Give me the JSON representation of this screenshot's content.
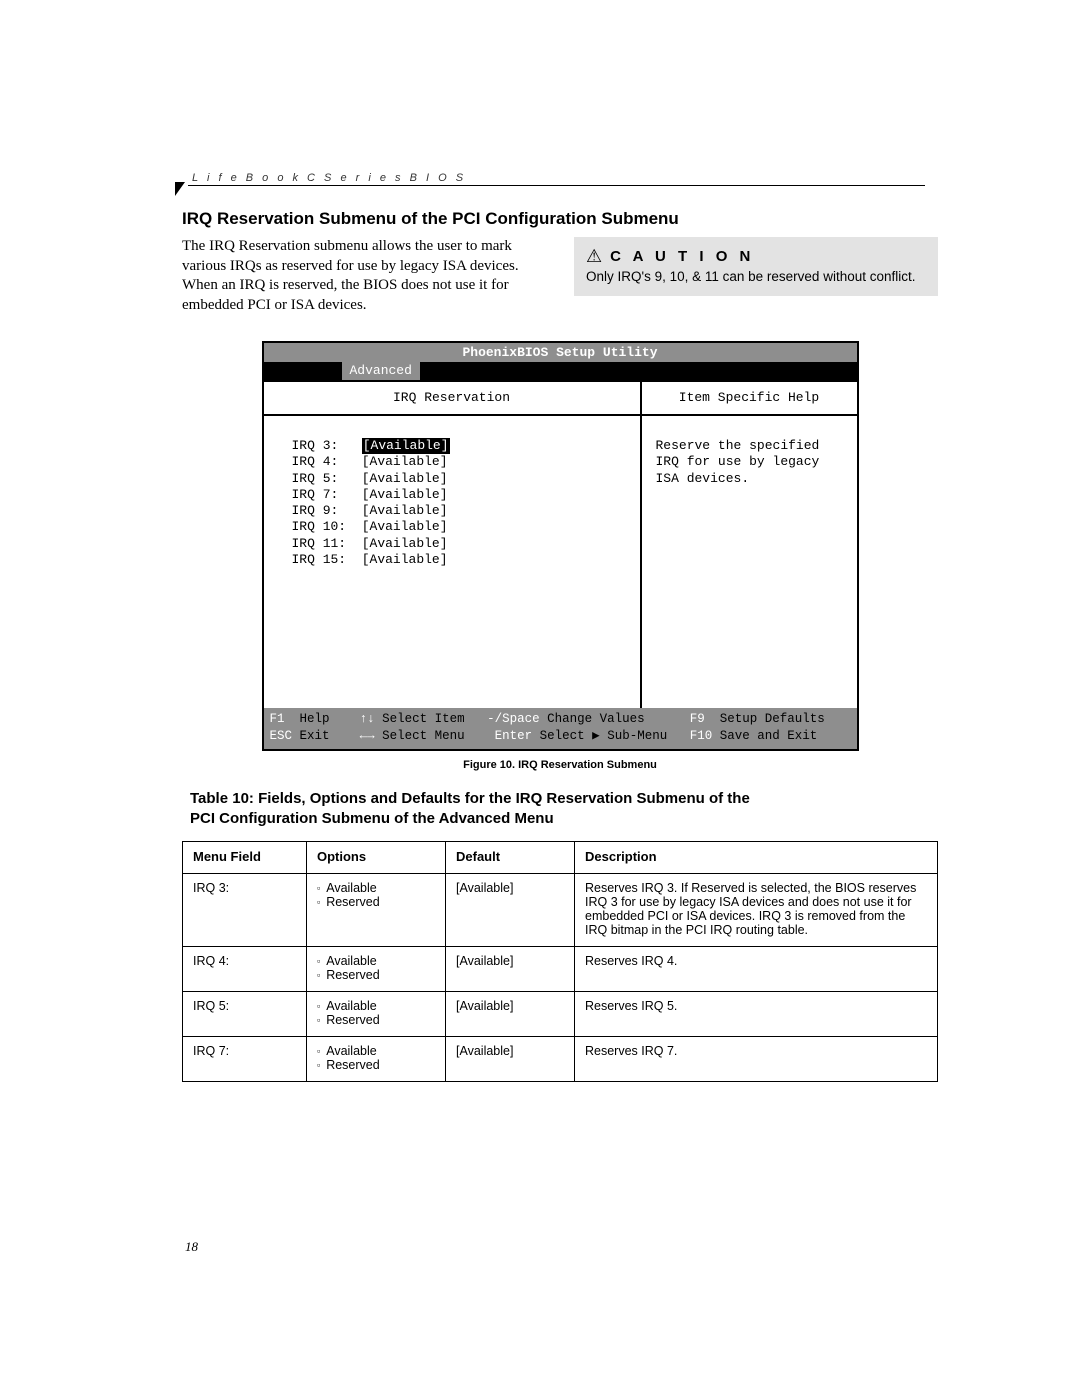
{
  "running_header": "L i f e B o o k   C   S e r i e s   B I O S",
  "section_title": "IRQ Reservation Submenu of the PCI Configuration Submenu",
  "intro_para": "The IRQ Reservation submenu allows the user to mark various IRQs as reserved for use by legacy ISA devices. When an IRQ is reserved, the BIOS does not use it for embedded PCI or ISA devices.",
  "caution": {
    "label": "C A U T I O N",
    "text": "Only IRQ's 9, 10, & 11 can be reserved without conflict."
  },
  "bios": {
    "title": "PhoenixBIOS Setup Utility",
    "tab": "Advanced",
    "left_title": "IRQ Reservation",
    "right_title": "Item Specific Help",
    "irqs": [
      {
        "label": "IRQ 3:",
        "value": "[Available]",
        "selected": true
      },
      {
        "label": "IRQ 4:",
        "value": "[Available]",
        "selected": false
      },
      {
        "label": "IRQ 5:",
        "value": "[Available]",
        "selected": false
      },
      {
        "label": "IRQ 7:",
        "value": "[Available]",
        "selected": false
      },
      {
        "label": "IRQ 9:",
        "value": "[Available]",
        "selected": false
      },
      {
        "label": "IRQ 10:",
        "value": "[Available]",
        "selected": false
      },
      {
        "label": "IRQ 11:",
        "value": "[Available]",
        "selected": false
      },
      {
        "label": "IRQ 15:",
        "value": "[Available]",
        "selected": false
      }
    ],
    "help_lines": [
      "Reserve the specified",
      "IRQ for use by legacy",
      "ISA devices."
    ],
    "nav": {
      "f1": "F1",
      "help": "Help",
      "updn": "↑↓",
      "select_item": "Select Item",
      "minus_space": "-/Space",
      "change_values": "Change Values",
      "f9": "F9",
      "setup_defaults": "Setup Defaults",
      "esc": "ESC",
      "exit": "Exit",
      "lr": "←→",
      "select_menu": "Select Menu",
      "enter": "Enter",
      "select_sub": "Select ▶ Sub-Menu",
      "f10": "F10",
      "save_exit": "Save and Exit"
    }
  },
  "fig_caption": "Figure 10.   IRQ Reservation Submenu",
  "table_caption_l1": "Table 10: Fields, Options and Defaults for the IRQ Reservation Submenu of the",
  "table_caption_l2": "PCI Configuration Submenu of the Advanced Menu",
  "table": {
    "headers": [
      "Menu Field",
      "Options",
      "Default",
      "Description"
    ],
    "rows": [
      {
        "field": "IRQ 3:",
        "options": [
          "Available",
          "Reserved"
        ],
        "default": "[Available]",
        "desc": "Reserves IRQ 3. If Reserved is selected, the BIOS reserves IRQ 3 for use by legacy ISA devices and does not use it for embedded PCI or ISA devices. IRQ 3 is removed from the IRQ bitmap in the PCI IRQ routing table."
      },
      {
        "field": "IRQ 4:",
        "options": [
          "Available",
          "Reserved"
        ],
        "default": "[Available]",
        "desc": "Reserves IRQ 4."
      },
      {
        "field": "IRQ 5:",
        "options": [
          "Available",
          "Reserved"
        ],
        "default": "[Available]",
        "desc": "Reserves IRQ 5."
      },
      {
        "field": "IRQ 7:",
        "options": [
          "Available",
          "Reserved"
        ],
        "default": "[Available]",
        "desc": "Reserves IRQ 7."
      }
    ]
  },
  "page_number": "18"
}
